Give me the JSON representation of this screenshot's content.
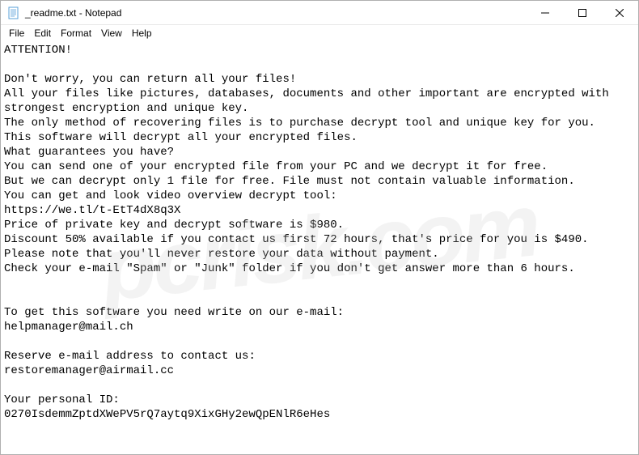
{
  "window": {
    "title": "_readme.txt - Notepad"
  },
  "menubar": {
    "file": "File",
    "edit": "Edit",
    "format": "Format",
    "view": "View",
    "help": "Help"
  },
  "content": {
    "text": "ATTENTION!\n\nDon't worry, you can return all your files!\nAll your files like pictures, databases, documents and other important are encrypted with strongest encryption and unique key.\nThe only method of recovering files is to purchase decrypt tool and unique key for you.\nThis software will decrypt all your encrypted files.\nWhat guarantees you have?\nYou can send one of your encrypted file from your PC and we decrypt it for free.\nBut we can decrypt only 1 file for free. File must not contain valuable information.\nYou can get and look video overview decrypt tool:\nhttps://we.tl/t-EtT4dX8q3X\nPrice of private key and decrypt software is $980.\nDiscount 50% available if you contact us first 72 hours, that's price for you is $490.\nPlease note that you'll never restore your data without payment.\nCheck your e-mail \"Spam\" or \"Junk\" folder if you don't get answer more than 6 hours.\n\n\nTo get this software you need write on our e-mail:\nhelpmanager@mail.ch\n\nReserve e-mail address to contact us:\nrestoremanager@airmail.cc\n\nYour personal ID:\n0270IsdemmZptdXWePV5rQ7aytq9XixGHy2ewQpENlR6eHes"
  },
  "watermark": {
    "text": "pcrisk.com"
  }
}
